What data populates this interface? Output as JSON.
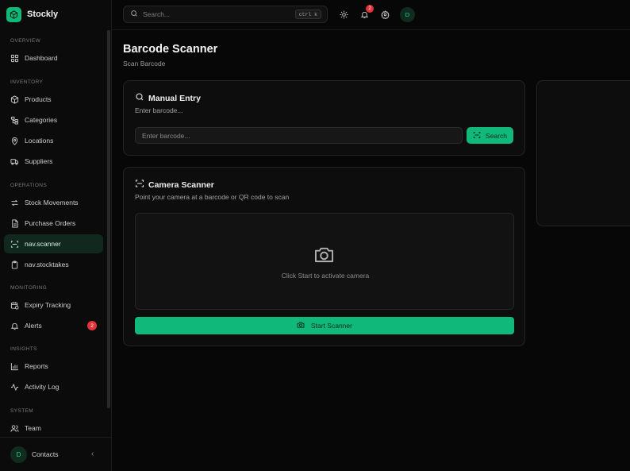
{
  "brand": {
    "name": "Stockly"
  },
  "sidebar": {
    "sections": {
      "overview": "OVERVIEW",
      "inventory": "INVENTORY",
      "operations": "OPERATIONS",
      "monitoring": "MONITORING",
      "insights": "INSIGHTS",
      "system": "SYSTEM"
    },
    "items": {
      "dashboard": "Dashboard",
      "products": "Products",
      "categories": "Categories",
      "locations": "Locations",
      "suppliers": "Suppliers",
      "stock_movements": "Stock Movements",
      "purchase_orders": "Purchase Orders",
      "scanner": "nav.scanner",
      "stocktakes": "nav.stocktakes",
      "expiry_tracking": "Expiry Tracking",
      "alerts": "Alerts",
      "alerts_badge": "2",
      "reports": "Reports",
      "activity_log": "Activity Log",
      "team": "Team"
    },
    "footer": {
      "avatar": "D",
      "label": "Contacts",
      "collapse": "‹"
    }
  },
  "topbar": {
    "search_placeholder": "Search...",
    "shortcut": "ctrl k",
    "notifications_count": "2",
    "avatar": "D"
  },
  "page": {
    "title": "Barcode Scanner",
    "subtitle": "Scan Barcode"
  },
  "manual_entry": {
    "title": "Manual Entry",
    "description": "Enter barcode...",
    "input_placeholder": "Enter barcode...",
    "button": "Search"
  },
  "camera_scanner": {
    "title": "Camera Scanner",
    "description": "Point your camera at a barcode or QR code to scan",
    "hint": "Click Start to activate camera",
    "button": "Start Scanner"
  },
  "colors": {
    "accent": "#10b97a",
    "background": "#070707",
    "card": "#0d0d0d",
    "badge": "#e0343a"
  }
}
